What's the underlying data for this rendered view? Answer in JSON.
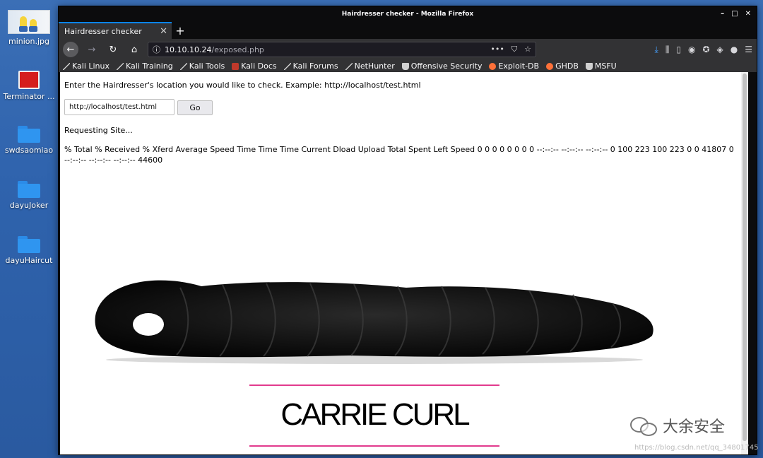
{
  "desktop": {
    "icons": [
      {
        "label": "minion.jpg"
      },
      {
        "label": "Terminator ..."
      },
      {
        "label": "swdsaomiao"
      },
      {
        "label": "dayuJoker"
      },
      {
        "label": "dayuHaircut"
      }
    ]
  },
  "window": {
    "title": "Hairdresser checker - Mozilla Firefox",
    "controls": {
      "minimize": "–",
      "maximize": "□",
      "close": "✕"
    }
  },
  "tabs": [
    {
      "label": "Hairdresser checker",
      "close": "✕"
    }
  ],
  "newtab_label": "+",
  "navbar": {
    "back": "←",
    "forward": "→",
    "reload": "↻",
    "home": "⌂",
    "url_host": "10.10.10.24",
    "url_path": "/exposed.php",
    "url_actions": "•••"
  },
  "bookmarks": [
    {
      "label": "Kali Linux",
      "icon": "kali-icon"
    },
    {
      "label": "Kali Training",
      "icon": "kali-icon"
    },
    {
      "label": "Kali Tools",
      "icon": "kali-icon"
    },
    {
      "label": "Kali Docs",
      "icon": "docs-icon"
    },
    {
      "label": "Kali Forums",
      "icon": "kali-icon"
    },
    {
      "label": "NetHunter",
      "icon": "kali-icon"
    },
    {
      "label": "Offensive Security",
      "icon": "offsec-icon"
    },
    {
      "label": "Exploit-DB",
      "icon": "exploit-icon"
    },
    {
      "label": "GHDB",
      "icon": "exploit-icon"
    },
    {
      "label": "MSFU",
      "icon": "offsec-icon"
    }
  ],
  "page": {
    "prompt": "Enter the Hairdresser's location you would like to check. Example: http://localhost/test.html",
    "input_value": "http://localhost/test.html",
    "go_label": "Go",
    "requesting": "Requesting Site...",
    "curl_output": "% Total % Received % Xferd Average Speed Time Time Time Current Dload Upload Total Spent Left Speed 0 0 0 0 0 0 0 0 --:--:-- --:--:-- --:--:-- 0 100 223 100 223 0 0 41807 0 --:--:-- --:--:-- --:--:-- 44600",
    "logo_text": "CARRIE CURL"
  },
  "watermark": {
    "brand": "大余安全",
    "url": "https://blog.csdn.net/qq_34801745"
  },
  "colors": {
    "accent": "#0a84ff",
    "logo_line": "#e23b8e",
    "desktop_bg": "#2f63ad"
  }
}
